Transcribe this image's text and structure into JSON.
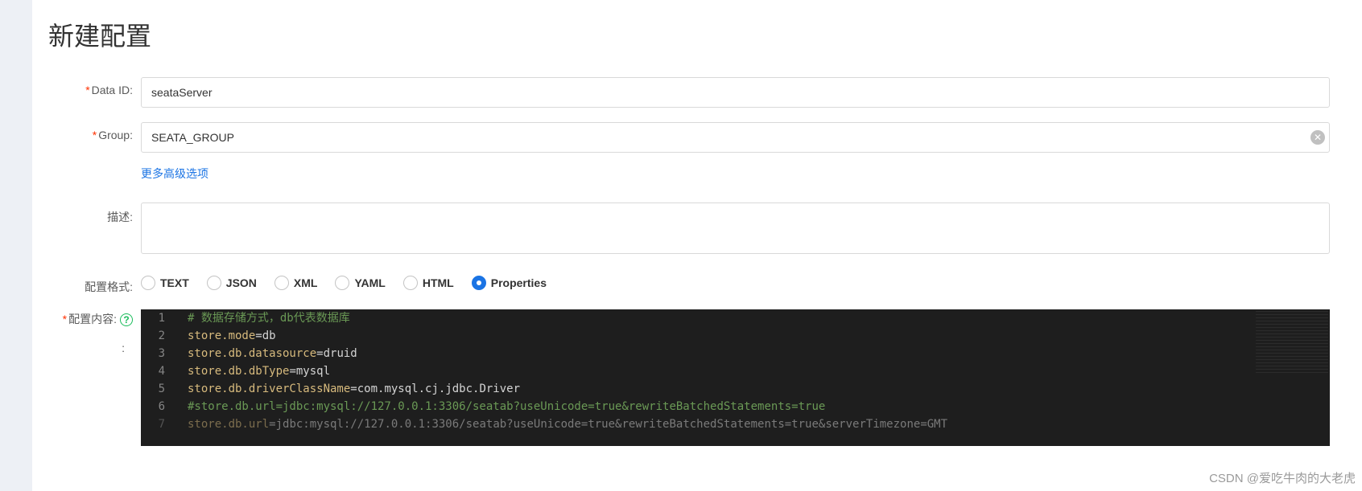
{
  "page_title": "新建配置",
  "fields": {
    "data_id": {
      "label": "Data ID:",
      "value": "seataServer"
    },
    "group": {
      "label": "Group:",
      "value": "SEATA_GROUP"
    },
    "advanced_link": "更多高级选项",
    "description": {
      "label": "描述:",
      "value": ""
    },
    "format": {
      "label": "配置格式:",
      "options": [
        "TEXT",
        "JSON",
        "XML",
        "YAML",
        "HTML",
        "Properties"
      ],
      "selected": "Properties"
    },
    "content": {
      "label": "配置内容:",
      "colon": ":",
      "lines": [
        {
          "n": 1,
          "type": "comment",
          "text": "# 数据存储方式，db代表数据库"
        },
        {
          "n": 2,
          "type": "kv",
          "key": "store.mode",
          "val": "db"
        },
        {
          "n": 3,
          "type": "kv",
          "key": "store.db.datasource",
          "val": "druid"
        },
        {
          "n": 4,
          "type": "kv",
          "key": "store.db.dbType",
          "val": "mysql"
        },
        {
          "n": 5,
          "type": "kv",
          "key": "store.db.driverClassName",
          "val": "com.mysql.cj.jdbc.Driver"
        },
        {
          "n": 6,
          "type": "comment",
          "text": "#store.db.url=jdbc:mysql://127.0.0.1:3306/seatab?useUnicode=true&rewriteBatchedStatements=true"
        },
        {
          "n": 7,
          "type": "kv-faded",
          "key": "store.db.url",
          "val": "jdbc:mysql://127.0.0.1:3306/seatab?useUnicode=true&rewriteBatchedStatements=true&serverTimezone=GMT"
        }
      ]
    }
  },
  "watermark": "CSDN @爱吃牛肉的大老虎"
}
